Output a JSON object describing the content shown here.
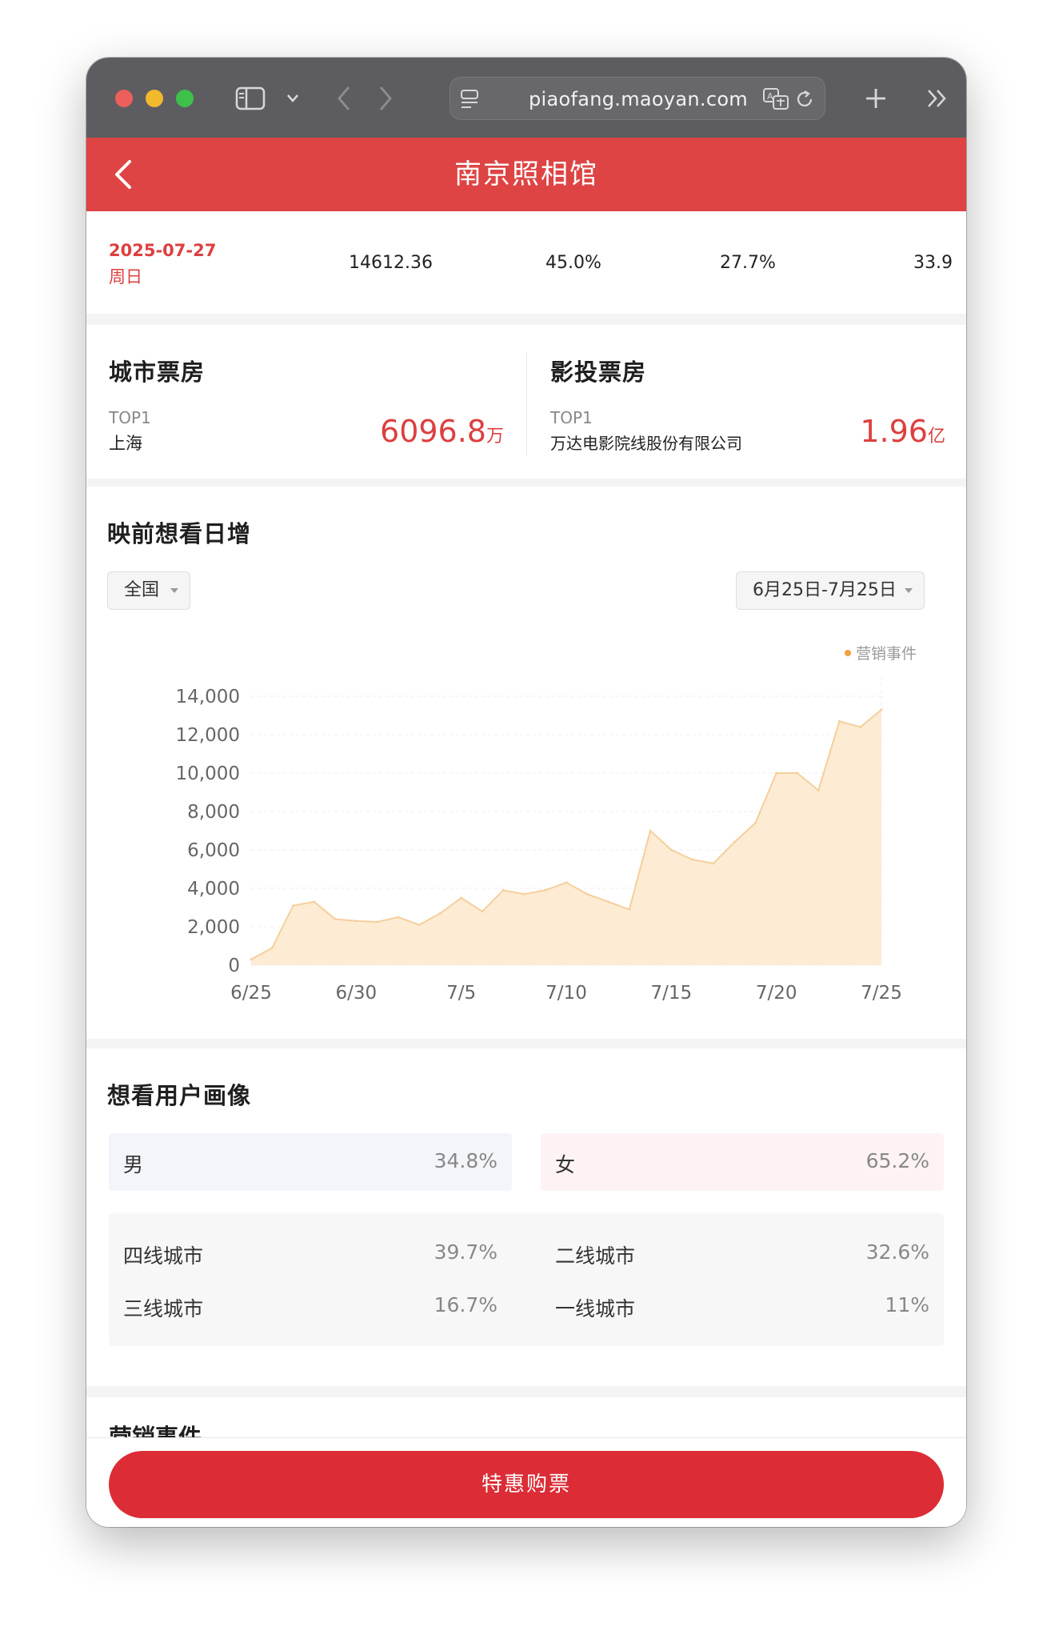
{
  "browser": {
    "url": "piaofang.maoyan.com"
  },
  "header": {
    "title": "南京照相馆"
  },
  "summary_row": {
    "date": "2025-07-27",
    "day": "周日",
    "values": [
      "14612.36",
      "45.0%",
      "27.7%",
      "33.9"
    ]
  },
  "city_box_office": {
    "title": "城市票房",
    "rank_label": "TOP1",
    "city": "上海",
    "value": "6096.8",
    "unit": "万"
  },
  "distributor_box_office": {
    "title": "影投票房",
    "rank_label": "TOP1",
    "company": "万达电影院线股份有限公司",
    "value": "1.96",
    "unit": "亿"
  },
  "want_to_see": {
    "title": "映前想看日增",
    "region_filter": "全国",
    "date_filter": "6月25日-7月25日",
    "legend_label": "营销事件"
  },
  "chart_data": {
    "type": "area",
    "x": [
      "6/25",
      "6/26",
      "6/27",
      "6/28",
      "6/29",
      "6/30",
      "7/1",
      "7/2",
      "7/3",
      "7/4",
      "7/5",
      "7/6",
      "7/7",
      "7/8",
      "7/9",
      "7/10",
      "7/11",
      "7/12",
      "7/13",
      "7/14",
      "7/15",
      "7/16",
      "7/17",
      "7/18",
      "7/19",
      "7/20",
      "7/21",
      "7/22",
      "7/23",
      "7/24",
      "7/25"
    ],
    "values": [
      300,
      900,
      3100,
      3300,
      2400,
      2300,
      2250,
      2500,
      2100,
      2700,
      3500,
      2800,
      3900,
      3700,
      3900,
      4300,
      3700,
      3300,
      2900,
      7000,
      6000,
      5500,
      5300,
      6400,
      7400,
      10000,
      10000,
      9100,
      12700,
      12400,
      13300
    ],
    "xticks": [
      "6/25",
      "6/30",
      "7/5",
      "7/10",
      "7/15",
      "7/20",
      "7/25"
    ],
    "yticks": [
      "0",
      "2,000",
      "4,000",
      "6,000",
      "8,000",
      "10,000",
      "12,000",
      "14,000"
    ],
    "ylim": [
      0,
      15000
    ],
    "fill_color": "#fdebd3",
    "line_color": "#f5cf9d",
    "grid": true
  },
  "audience_profile": {
    "title": "想看用户画像",
    "gender": [
      {
        "label": "男",
        "value": "34.8%"
      },
      {
        "label": "女",
        "value": "65.2%"
      }
    ],
    "city_tiers": [
      {
        "label": "四线城市",
        "value": "39.7%"
      },
      {
        "label": "二线城市",
        "value": "32.6%"
      },
      {
        "label": "三线城市",
        "value": "16.7%"
      },
      {
        "label": "一线城市",
        "value": "11%"
      }
    ]
  },
  "next_section_title": "营销事件",
  "buy_button": {
    "label": "特惠购票"
  },
  "colors": {
    "brand_red": "#de4444",
    "button_red": "#dc2c35",
    "accent_red_text": "#dd3f3f"
  }
}
